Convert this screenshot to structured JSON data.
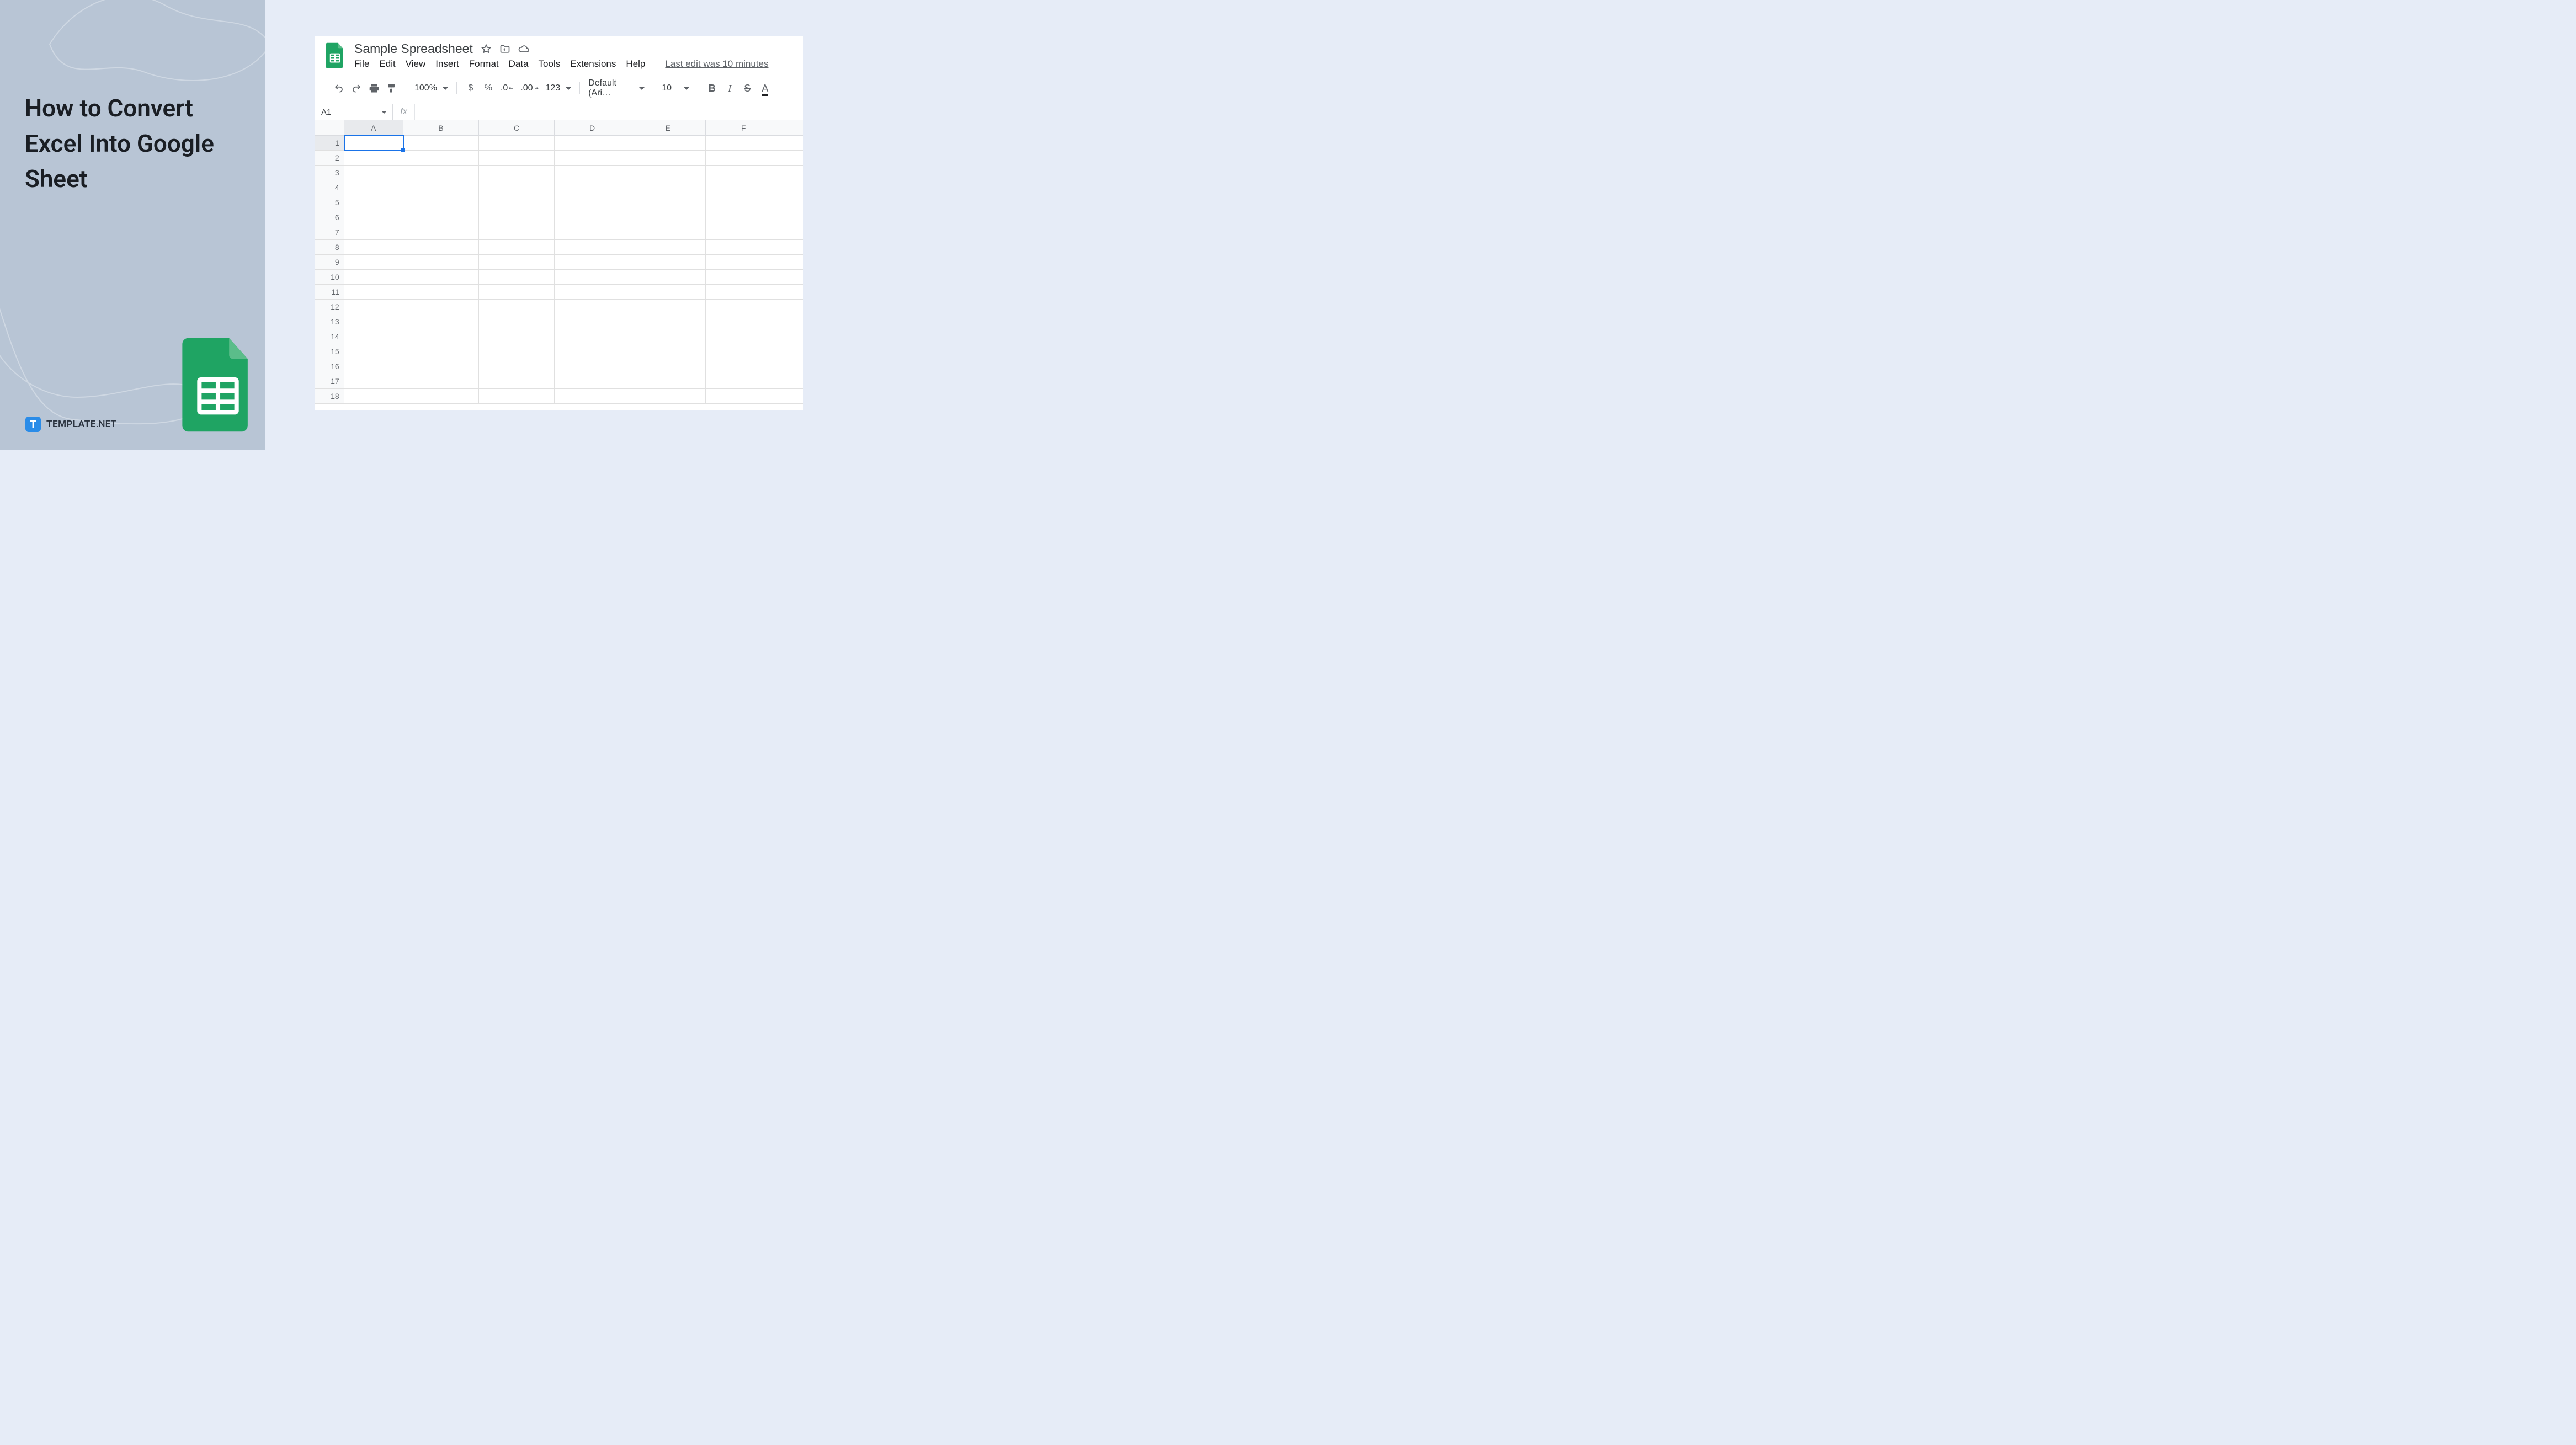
{
  "leftPanel": {
    "headline": "How to Convert Excel Into Google Sheet",
    "brand": {
      "icon_letter": "T",
      "name1": "TEMPLATE",
      "name2": ".NET"
    }
  },
  "sheets": {
    "doc_title": "Sample Spreadsheet",
    "menu": [
      "File",
      "Edit",
      "View",
      "Insert",
      "Format",
      "Data",
      "Tools",
      "Extensions",
      "Help"
    ],
    "last_edit": "Last edit was 10 minutes",
    "toolbar": {
      "zoom": "100%",
      "currency": "$",
      "percent": "%",
      "dec_dec": ".0",
      "dec_inc": ".00",
      "more_formats": "123",
      "font_name": "Default (Ari…",
      "font_size": "10",
      "bold": "B",
      "italic": "I",
      "strike": "S",
      "textcolor": "A"
    },
    "namebox": "A1",
    "fx_label": "fx",
    "columns": [
      "A",
      "B",
      "C",
      "D",
      "E",
      "F"
    ],
    "rows": [
      "1",
      "2",
      "3",
      "4",
      "5",
      "6",
      "7",
      "8",
      "9",
      "10",
      "11",
      "12",
      "13",
      "14",
      "15",
      "16",
      "17",
      "18"
    ],
    "active_cell": "A1"
  }
}
